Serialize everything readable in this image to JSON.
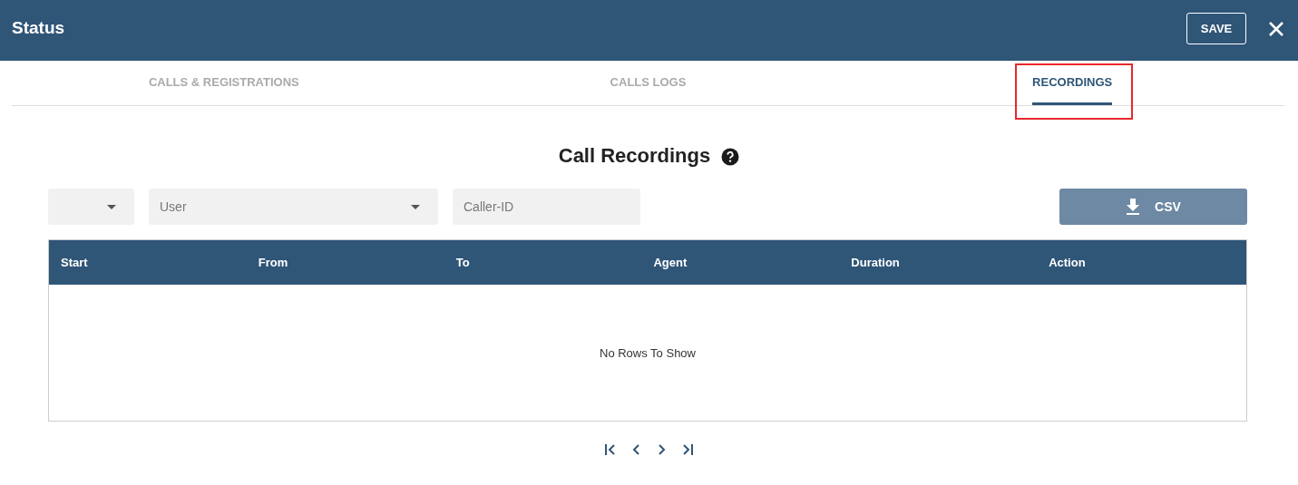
{
  "window": {
    "title": "Status",
    "save_button": "SAVE"
  },
  "tabs": [
    {
      "label": "CALLS & REGISTRATIONS",
      "selected": false,
      "highlighted": false
    },
    {
      "label": "CALLS LOGS",
      "selected": false,
      "highlighted": false
    },
    {
      "label": "RECORDINGS",
      "selected": true,
      "highlighted": true
    }
  ],
  "heading": "Call Recordings",
  "filters": {
    "period": {
      "kind": "dropdown"
    },
    "user": {
      "placeholder": "User"
    },
    "caller_id": {
      "placeholder": "Caller-ID"
    }
  },
  "csv_button": {
    "label": "CSV",
    "disabled": true
  },
  "table": {
    "columns": [
      "Start",
      "From",
      "To",
      "Agent",
      "Duration",
      "Action"
    ],
    "empty_text": "No Rows To Show"
  }
}
